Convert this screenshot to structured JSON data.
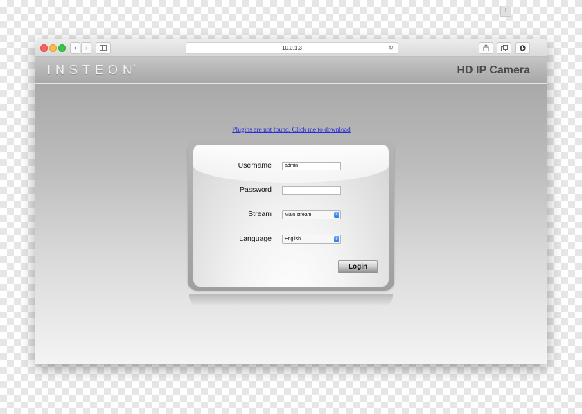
{
  "browser": {
    "address": "10.0.1.3",
    "back_icon": "‹",
    "forward_icon": "›",
    "new_tab_label": "+"
  },
  "header": {
    "brand": "INSTEON",
    "brand_mark": "®",
    "product": "HD IP Camera"
  },
  "plugin_notice": "Plugins are not found, Click me to download",
  "login": {
    "username_label": "Username",
    "username_value": "admin",
    "password_label": "Password",
    "password_value": "",
    "stream_label": "Stream",
    "stream_value": "Main stream",
    "language_label": "Language",
    "language_value": "English",
    "login_button": "Login"
  },
  "colors": {
    "link": "#2b2bd8",
    "select_accent": "#2b78e4"
  }
}
